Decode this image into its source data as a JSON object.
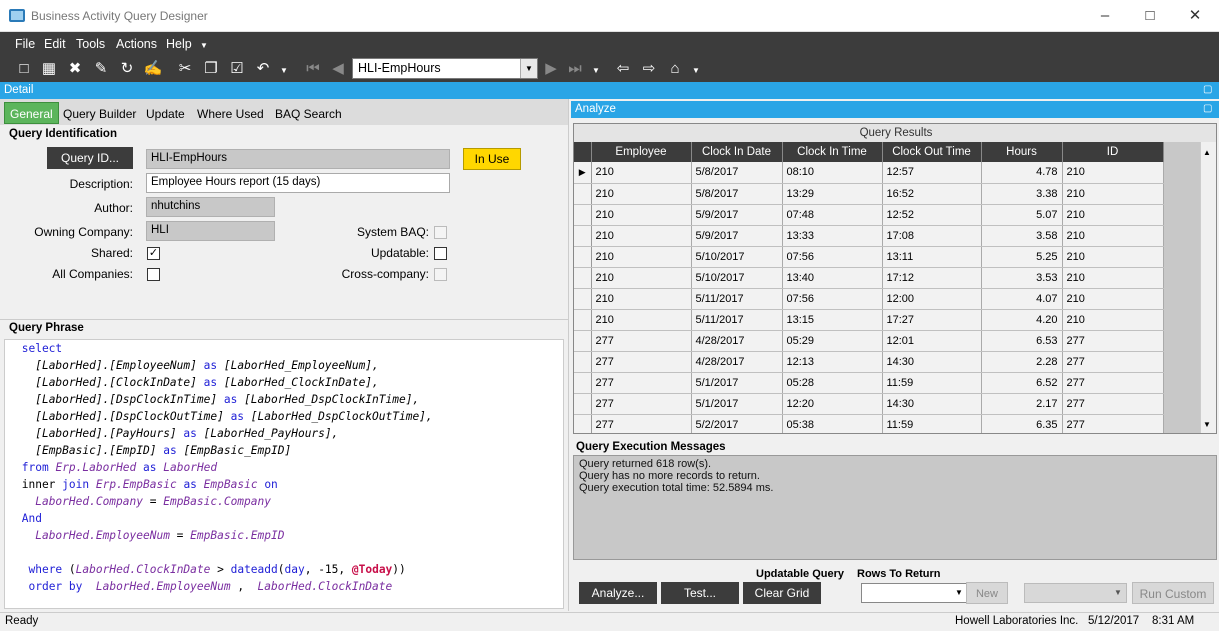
{
  "window": {
    "title": "Business Activity Query Designer"
  },
  "menu": [
    "File",
    "Edit",
    "Tools",
    "Actions",
    "Help"
  ],
  "toolbar": {
    "query_id": "HLI-EmpHours"
  },
  "detail": {
    "header": "Detail",
    "tabs": [
      "General",
      "Query Builder",
      "Update",
      "Where Used",
      "BAQ Search"
    ],
    "identification": {
      "title": "Query Identification",
      "query_id_button": "Query ID...",
      "query_id_value": "HLI-EmpHours",
      "in_use_label": "In Use",
      "description_label": "Description:",
      "description_value": "Employee Hours report (15 days)",
      "author_label": "Author:",
      "author_value": "nhutchins",
      "company_label": "Owning Company:",
      "company_value": "HLI",
      "shared_label": "Shared:",
      "all_companies_label": "All Companies:",
      "system_baq_label": "System BAQ:",
      "updatable_label": "Updatable:",
      "cross_company_label": "Cross-company:"
    },
    "phrase_title": "Query Phrase"
  },
  "analyze": {
    "header": "Analyze",
    "grid_caption": "Query Results",
    "columns": [
      "Employee",
      "Clock In Date",
      "Clock In Time",
      "Clock Out Time",
      "Hours",
      "ID"
    ],
    "rows": [
      [
        "210",
        "5/8/2017",
        "08:10",
        "12:57",
        "4.78",
        "210"
      ],
      [
        "210",
        "5/8/2017",
        "13:29",
        "16:52",
        "3.38",
        "210"
      ],
      [
        "210",
        "5/9/2017",
        "07:48",
        "12:52",
        "5.07",
        "210"
      ],
      [
        "210",
        "5/9/2017",
        "13:33",
        "17:08",
        "3.58",
        "210"
      ],
      [
        "210",
        "5/10/2017",
        "07:56",
        "13:11",
        "5.25",
        "210"
      ],
      [
        "210",
        "5/10/2017",
        "13:40",
        "17:12",
        "3.53",
        "210"
      ],
      [
        "210",
        "5/11/2017",
        "07:56",
        "12:00",
        "4.07",
        "210"
      ],
      [
        "210",
        "5/11/2017",
        "13:15",
        "17:27",
        "4.20",
        "210"
      ],
      [
        "277",
        "4/28/2017",
        "05:29",
        "12:01",
        "6.53",
        "277"
      ],
      [
        "277",
        "4/28/2017",
        "12:13",
        "14:30",
        "2.28",
        "277"
      ],
      [
        "277",
        "5/1/2017",
        "05:28",
        "11:59",
        "6.52",
        "277"
      ],
      [
        "277",
        "5/1/2017",
        "12:20",
        "14:30",
        "2.17",
        "277"
      ],
      [
        "277",
        "5/2/2017",
        "05:38",
        "11:59",
        "6.35",
        "277"
      ]
    ],
    "messages_title": "Query Execution Messages",
    "messages": [
      "Query returned 618 row(s).",
      "Query has no more records to return.",
      "Query execution total time: 52.5894 ms."
    ],
    "buttons": {
      "analyze": "Analyze...",
      "test": "Test...",
      "clear_grid": "Clear Grid",
      "new": "New",
      "run_custom": "Run Custom"
    },
    "updatable_query_label": "Updatable Query",
    "rows_to_return_label": "Rows To Return"
  },
  "status": {
    "left": "Ready",
    "company": "Howell Laboratories Inc.",
    "date": "5/12/2017",
    "time": "8:31 AM"
  },
  "colors": {
    "accent": "#2aa5e6",
    "toolbar": "#3c3c3c",
    "active_tab": "#5cb55c",
    "in_use": "#ffd700"
  }
}
